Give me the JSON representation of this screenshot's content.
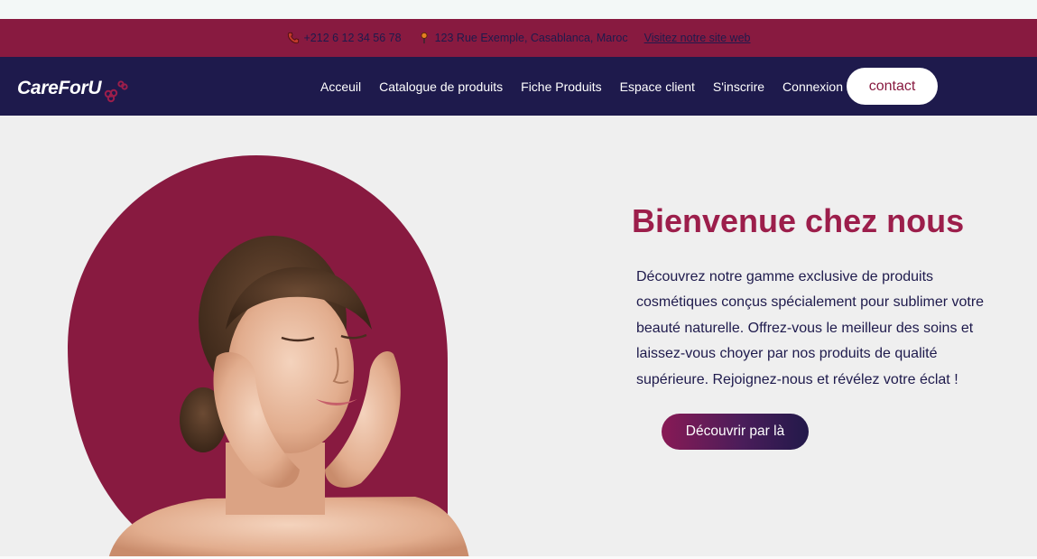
{
  "topbar": {
    "phone": "+212 6 12 34 56 78",
    "address": "123 Rue Exemple, Casablanca, Maroc",
    "website_link": "Visitez notre site web"
  },
  "navbar": {
    "logo_text": "CareForU",
    "links": [
      "Acceuil",
      "Catalogue de produits",
      "Fiche Produits",
      "Espace client",
      "S'inscrire",
      "Connexion"
    ],
    "contact_label": "contact"
  },
  "hero": {
    "title": "Bienvenue chez nous",
    "text": "Découvrez notre gamme exclusive de produits cosmétiques conçus spécialement pour sublimer votre beauté naturelle. Offrez-vous le meilleur des soins et laissez-vous choyer par nos produits de qualité supérieure. Rejoignez-nous et révélez votre éclat !",
    "cta_label": "Découvrir par là"
  },
  "colors": {
    "brand_crimson": "#881a40",
    "navy": "#1e1a4c",
    "title_color": "#9c1e4b"
  },
  "icons": [
    "phone-icon",
    "map-pin-icon",
    "flower-logo-icon"
  ]
}
